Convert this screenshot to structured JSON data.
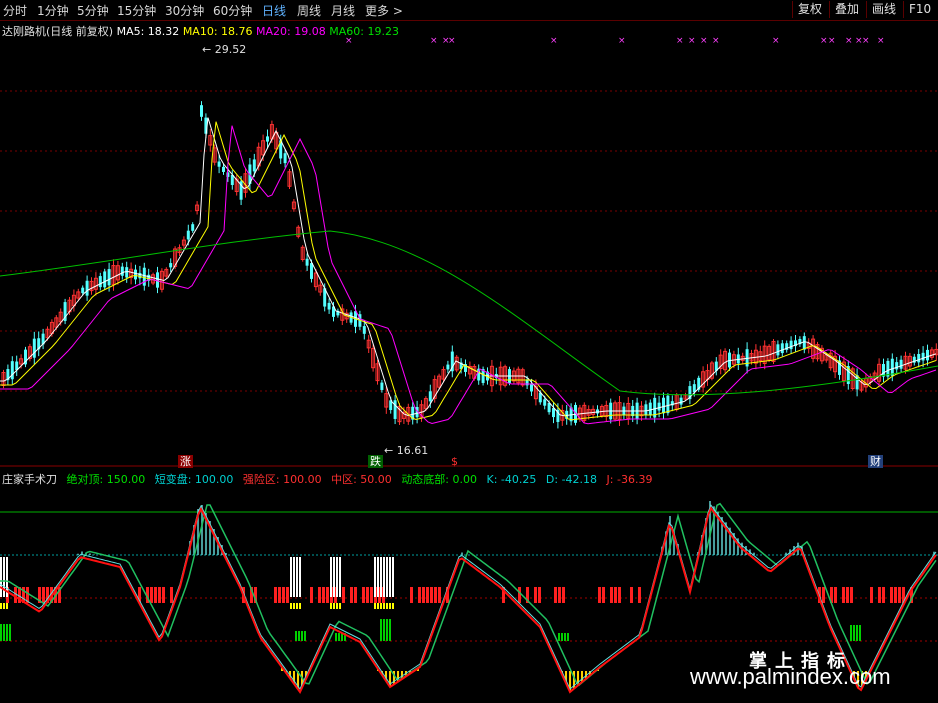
{
  "toolbar": {
    "periods": [
      "分时",
      "1分钟",
      "5分钟",
      "15分钟",
      "30分钟",
      "60分钟",
      "日线",
      "周线",
      "月线",
      "更多 >"
    ],
    "active_index": 6,
    "right_buttons": [
      "复权",
      "叠加",
      "画线",
      "F10"
    ]
  },
  "main_legend": {
    "title": "达刚路机(日线 前复权)",
    "ma5": "MA5: 18.32",
    "ma10": "MA10: 18.76",
    "ma20": "MA20: 19.08",
    "ma60": "MA60: 19.23",
    "colors": {
      "ma5": "#ffffff",
      "ma10": "#ffff00",
      "ma20": "#ff00ff",
      "ma60": "#00c000"
    }
  },
  "annotations": {
    "high": "29.52",
    "low": "16.61",
    "tag_zhang": "涨",
    "tag_die": "跌",
    "tag_s": "$",
    "tag_cai": "财"
  },
  "indicator_legend": {
    "name": "庄家手术刀",
    "abs_top": "绝对顶: 150.00",
    "short_hold": "短变盘: 100.00",
    "danger": "强险区: 100.00",
    "mid": "中区: 50.00",
    "bottom": "动态底部: 0.00",
    "k": "K: -40.25",
    "d": "D: -42.18",
    "j": "J: -36.39"
  },
  "watermark": {
    "cn": "掌上指标",
    "url": "www.palmindex.com"
  },
  "colors": {
    "up": "#ff3232",
    "down": "#54ffff",
    "grid": "#7a0000"
  }
}
